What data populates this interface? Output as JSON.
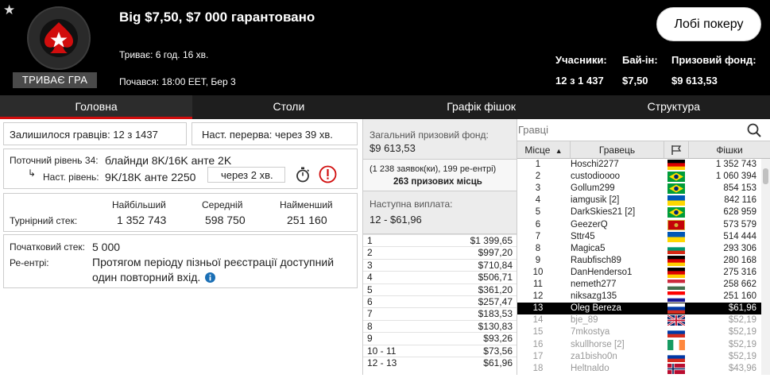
{
  "header": {
    "title": "Big $7,50, $7 000 гарантовано",
    "duration": "Триває: 6 год. 16 хв.",
    "started": "Почався: 18:00 EET, Бер 3",
    "status": "ТРИВАЄ ГРА",
    "lobby_button": "Лобі покеру",
    "stats": {
      "players_label": "Учасники:",
      "players_value": "12 з 1 437",
      "buyin_label": "Бай-ін:",
      "buyin_value": "$7,50",
      "prize_label": "Призовий фонд:",
      "prize_value": "$9 613,53"
    }
  },
  "tabs": [
    "Головна",
    "Столи",
    "Графік фішок",
    "Структура"
  ],
  "info": {
    "players_left": "Залишилося гравців: 12 з 1437",
    "next_break": "Наст. перерва: через 39 хв.",
    "current_level_label": "Поточний рівень 34:",
    "current_level_value": "блайнди 8K/16K анте 2K",
    "next_level_arrow": "↳",
    "next_level_label": "Наст. рівень:",
    "next_level_value": "9K/18K анте 2250",
    "next_level_time": "через 2 хв.",
    "stack_headers": [
      "Найбільший",
      "Середній",
      "Найменший"
    ],
    "stack_label": "Турнірний стек:",
    "stack_values": [
      "1 352 743",
      "598 750",
      "251 160"
    ],
    "starting_stack_label": "Початковий стек:",
    "starting_stack_value": "5 000",
    "reentry_label": "Ре-ентрі:",
    "reentry_line1": "Протягом періоду пізньої реєстрації доступний",
    "reentry_line2": "один повторний вхід."
  },
  "prizes": {
    "total_label": "Загальний призовий фонд:",
    "total_value": "$9 613,53",
    "entries": "(1 238 заявок(ки), 199 ре-ентрі)",
    "places": "263 призових місць",
    "next_payout_label": "Наступна виплата:",
    "next_payout_value": "12 - $61,96",
    "payouts": [
      {
        "place": "1",
        "amount": "$1 399,65"
      },
      {
        "place": "2",
        "amount": "$997,20"
      },
      {
        "place": "3",
        "amount": "$710,84"
      },
      {
        "place": "4",
        "amount": "$506,71"
      },
      {
        "place": "5",
        "amount": "$361,20"
      },
      {
        "place": "6",
        "amount": "$257,47"
      },
      {
        "place": "7",
        "amount": "$183,53"
      },
      {
        "place": "8",
        "amount": "$130,83"
      },
      {
        "place": "9",
        "amount": "$93,26"
      },
      {
        "place": "10 - 11",
        "amount": "$73,56"
      },
      {
        "place": "12 - 13",
        "amount": "$61,96"
      }
    ]
  },
  "players": {
    "search_placeholder": "Гравці",
    "columns": {
      "place": "Місце",
      "sort_arrow": "▲",
      "player": "Гравець",
      "chips": "Фішки"
    },
    "rows": [
      {
        "place": "1",
        "name": "Hoschi2277",
        "chips": "1 352 743",
        "flag": "de"
      },
      {
        "place": "2",
        "name": "custodioooo",
        "chips": "1 060 394",
        "flag": "br"
      },
      {
        "place": "3",
        "name": "Gollum299",
        "chips": "854 153",
        "flag": "br"
      },
      {
        "place": "4",
        "name": "iamgusik [2]",
        "chips": "842 116",
        "flag": "ua"
      },
      {
        "place": "5",
        "name": "DarkSkies21 [2]",
        "chips": "628 959",
        "flag": "br"
      },
      {
        "place": "6",
        "name": "GeezerQ",
        "chips": "573 579",
        "flag": "me"
      },
      {
        "place": "7",
        "name": "Sttr45",
        "chips": "514 444",
        "flag": "ua"
      },
      {
        "place": "8",
        "name": "Magica5",
        "chips": "293 306",
        "flag": "bg"
      },
      {
        "place": "9",
        "name": "Raubfisch89",
        "chips": "280 168",
        "flag": "de"
      },
      {
        "place": "10",
        "name": "DanHenderso1",
        "chips": "275 316",
        "flag": "de"
      },
      {
        "place": "11",
        "name": "nemeth277",
        "chips": "258 662",
        "flag": "hu"
      },
      {
        "place": "12",
        "name": "niksazg135",
        "chips": "251 160",
        "flag": "hr"
      },
      {
        "place": "13",
        "name": "Oleg Bereza",
        "chips": "$61,96",
        "flag": "ru"
      },
      {
        "place": "14",
        "name": "bje_89",
        "chips": "$52,19",
        "flag": "gb"
      },
      {
        "place": "15",
        "name": "7mkostya",
        "chips": "$52,19",
        "flag": "ru"
      },
      {
        "place": "16",
        "name": "skullhorse [2]",
        "chips": "$52,19",
        "flag": "ie"
      },
      {
        "place": "17",
        "name": "za1bisho0n",
        "chips": "$52,19",
        "flag": "ru"
      },
      {
        "place": "18",
        "name": "Heltnaldo",
        "chips": "$43,96",
        "flag": "no"
      }
    ]
  },
  "colors": {
    "accent_red": "#d10d0d",
    "header_bg": "#000000",
    "info_blue": "#1a6fb5"
  }
}
